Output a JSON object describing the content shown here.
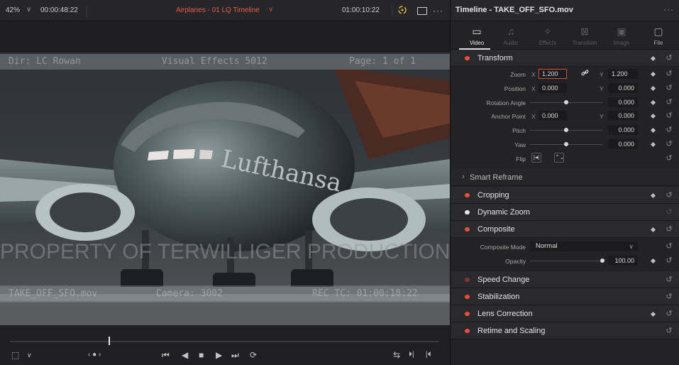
{
  "viewer": {
    "zoom_level": "42%",
    "zoom_chevron": "∨",
    "timecode_left": "00:00:48:22",
    "timeline_name": "Airplanes - 01 LQ Timeline",
    "timeline_chevron": "∨",
    "timecode_right": "01:00:10:22",
    "more": "···",
    "overlay": {
      "top_left": "Dir: LC Rowan",
      "top_center": "Visual Effects 5012",
      "top_right": "Page: 1 of 1",
      "watermark": "PROPERTY OF TERWILLIGER PRODUCTIONS",
      "bottom_left": "TAKE_OFF_SFO.mov",
      "bottom_center": "Camera: 3002",
      "bottom_right": "REC TC: 01:00:18:22"
    },
    "playhead_position": 0.23
  },
  "transport": {
    "first": "⏮",
    "prev": "◀",
    "stop": "■",
    "play": "▶",
    "last": "⏭",
    "loop": "⟳",
    "nav": "‹ ● ›",
    "crop_icon": "⬚",
    "crop_chevron": "∨",
    "match": "⇆",
    "in": "⏵|",
    "out": "|⏴"
  },
  "inspector": {
    "title": "Timeline - TAKE_OFF_SFO.mov",
    "more": "···",
    "tabs": [
      {
        "label": "Video",
        "icon": "film-icon",
        "glyph": "▭",
        "state": "active"
      },
      {
        "label": "Audio",
        "icon": "music-icon",
        "glyph": "♫",
        "state": "dim"
      },
      {
        "label": "Effects",
        "icon": "magic-wand-icon",
        "glyph": "✧",
        "state": "dim"
      },
      {
        "label": "Transition",
        "icon": "transition-icon",
        "glyph": "⊠",
        "state": "dim"
      },
      {
        "label": "Image",
        "icon": "image-icon",
        "glyph": "▣",
        "state": "dim"
      },
      {
        "label": "File",
        "icon": "file-icon",
        "glyph": "▢",
        "state": "on"
      }
    ],
    "transform": {
      "title": "Transform",
      "zoom": {
        "label": "Zoom",
        "x_axis": "X",
        "x": "1.200",
        "y_axis": "Y",
        "y": "1.200"
      },
      "position": {
        "label": "Position",
        "x_axis": "X",
        "x": "0.000",
        "y_axis": "Y",
        "y": "0.000"
      },
      "rotation": {
        "label": "Rotation Angle",
        "value": "0.000"
      },
      "anchor": {
        "label": "Anchor Point",
        "x_axis": "X",
        "x": "0.000",
        "y_axis": "Y",
        "y": "0.000"
      },
      "pitch": {
        "label": "Pitch",
        "value": "0.000"
      },
      "yaw": {
        "label": "Yaw",
        "value": "0.000"
      },
      "flip": {
        "label": "Flip",
        "h": "|◂|",
        "v": "⌃⌄"
      }
    },
    "smart_reframe": {
      "title": "Smart Reframe",
      "chevron": "›"
    },
    "cropping": {
      "title": "Cropping"
    },
    "dynamic_zoom": {
      "title": "Dynamic Zoom"
    },
    "composite": {
      "title": "Composite",
      "mode_label": "Composite Mode",
      "mode_value": "Normal",
      "opacity_label": "Opacity",
      "opacity_value": "100.00"
    },
    "speed_change": {
      "title": "Speed Change"
    },
    "stabilization": {
      "title": "Stabilization"
    },
    "lens_correction": {
      "title": "Lens Correction"
    },
    "retime_scaling": {
      "title": "Retime and Scaling"
    },
    "reset_glyph": "↺",
    "link_glyph": "🔗"
  },
  "colors": {
    "accent": "#e5503c",
    "panel": "#232326",
    "section": "#2a2a2e"
  }
}
